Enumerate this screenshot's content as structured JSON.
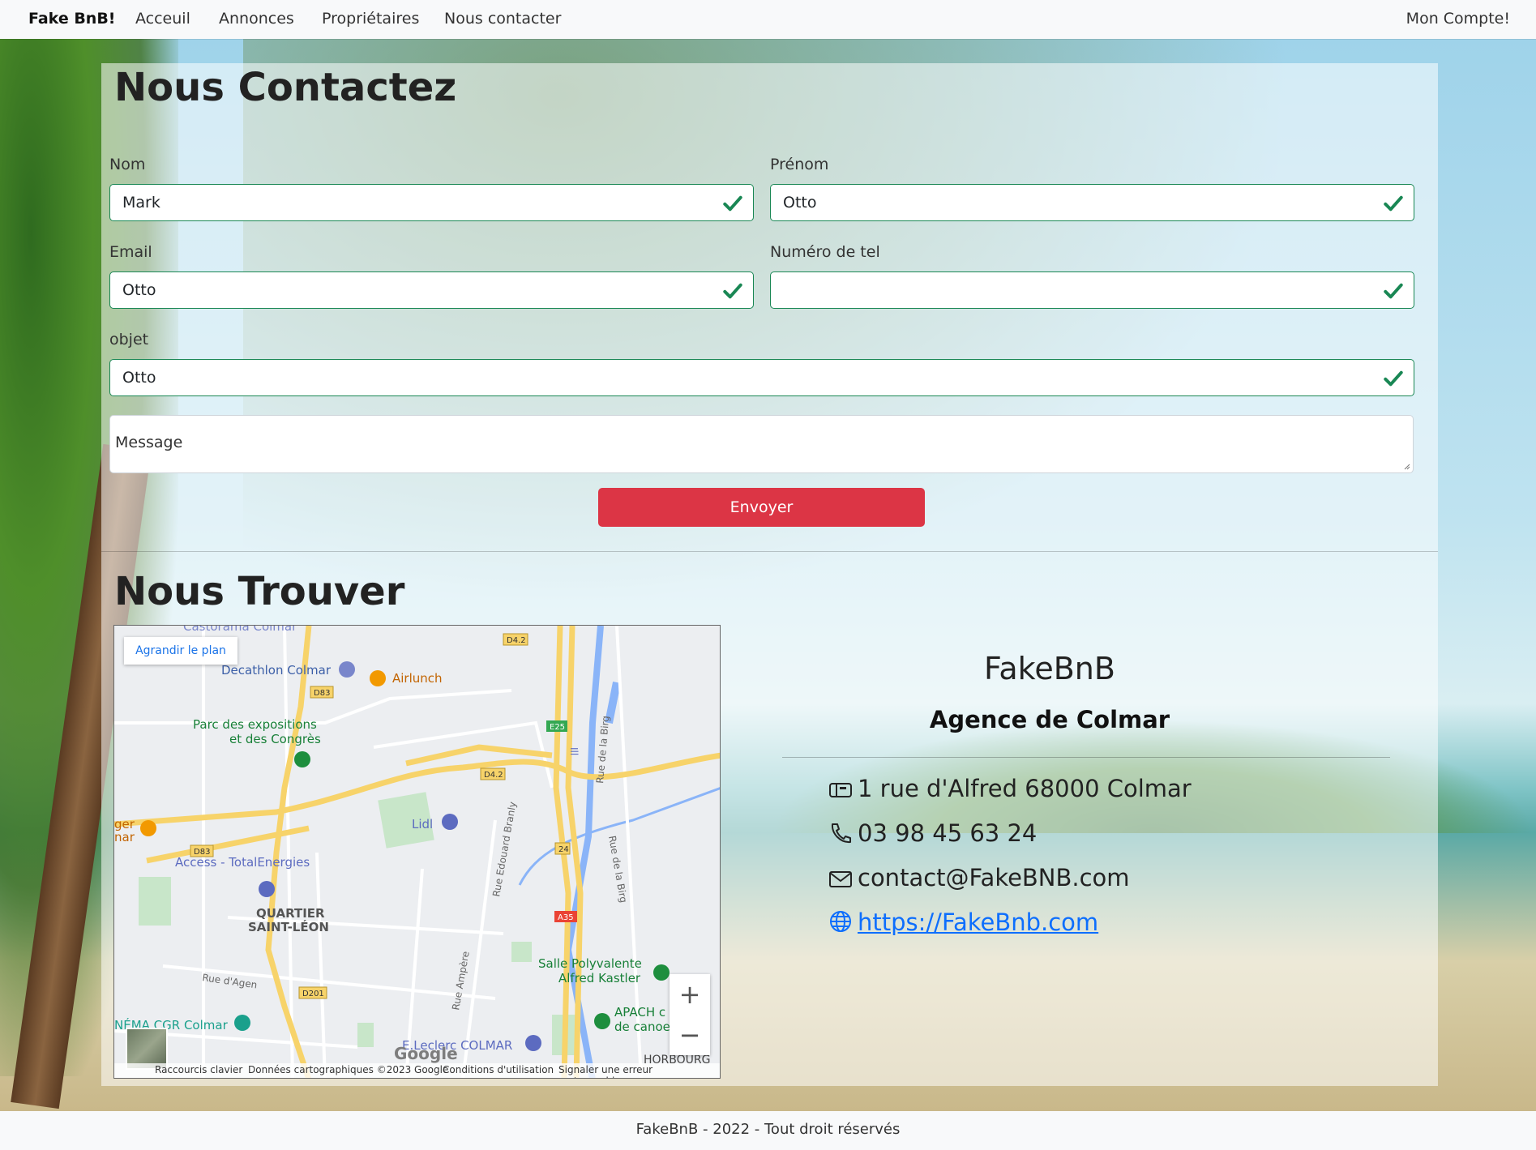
{
  "navbar": {
    "brand": "Fake BnB!",
    "links": [
      "Acceuil",
      "Annonces",
      "Propriétaires",
      "Nous contacter"
    ],
    "account": "Mon Compte!"
  },
  "contact": {
    "title": "Nous Contactez",
    "fields": {
      "nom": {
        "label": "Nom",
        "value": "Mark"
      },
      "prenom": {
        "label": "Prénom",
        "value": "Otto"
      },
      "email": {
        "label": "Email",
        "value": "Otto"
      },
      "tel": {
        "label": "Numéro de tel",
        "value": ""
      },
      "objet": {
        "label": "objet",
        "value": "Otto"
      }
    },
    "message_placeholder": "Message",
    "submit_label": "Envoyer",
    "valid_color": "#198754",
    "button_color": "#dc3545"
  },
  "find": {
    "title": "Nous Trouver",
    "map": {
      "enlarge_label": "Agrandir le plan",
      "labels": {
        "castorama": "Castorama Colmar",
        "decathlon": "Decathlon Colmar",
        "airlunch": "Airlunch",
        "parc1": "Parc des expositions",
        "parc2": "et des Congrès",
        "lidl": "Lidl",
        "access": "Access - TotalEnergies",
        "quartier1": "QUARTIER",
        "quartier2": "SAINT-LÉON",
        "salle1": "Salle Polyvalente",
        "salle2": "Alfred Kastler",
        "apach1": "APACH c",
        "apach2": "de canoe",
        "cinema": "NÉMA CGR Colmar",
        "leclerc": "E.Leclerc COLMAR",
        "horbourg": "HORBOURG",
        "ger": "ger",
        "nar": "nar",
        "rue_agen": "Rue d'Agen",
        "rue_ampere": "Rue Ampère",
        "rue_branly": "Rue Edouard Branly",
        "rue_birg1": "Rue de la Birg",
        "rue_birg2": "Rue de la Birg",
        "d42a": "D4.2",
        "d42b": "D4.2",
        "d83a": "D83",
        "d83b": "D83",
        "e25": "E25",
        "d201": "D201",
        "a35": "A35",
        "r24": "24",
        "lll": "Ill"
      },
      "zoom_in": "+",
      "zoom_out": "−",
      "google": "Google",
      "footer": {
        "shortcuts": "Raccourcis clavier",
        "data": "Données cartographiques ©2023 Google",
        "terms": "Conditions d'utilisation",
        "report": "Signaler une erreur cartographique"
      }
    },
    "company": "FakeBnB",
    "agency": "Agence de Colmar",
    "address": "1 rue d'Alfred 68000 Colmar",
    "phone": "03 98 45 63 24",
    "email": "contact@FakeBNB.com",
    "website": "https://FakeBnb.com"
  },
  "footer": {
    "text": "FakeBnB - 2022 - Tout droit réservés"
  }
}
